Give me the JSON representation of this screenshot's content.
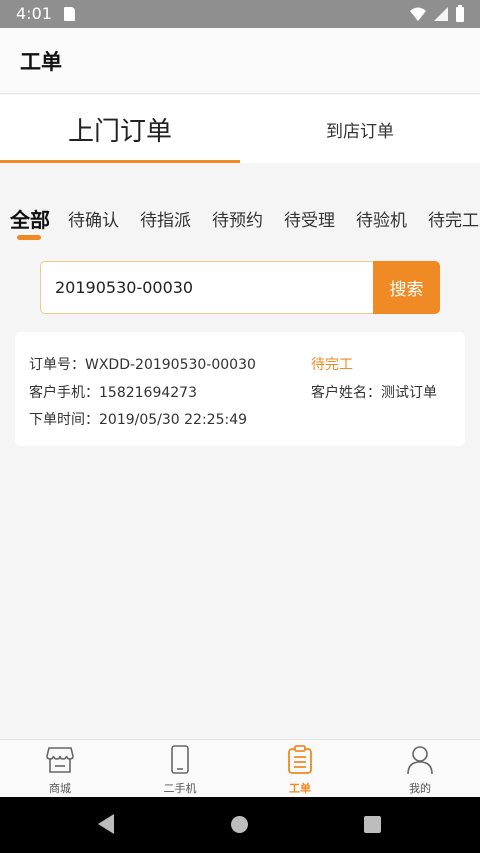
{
  "status_bar": {
    "time": "4:01"
  },
  "header": {
    "title": "工单"
  },
  "main_tabs": [
    {
      "label": "上门订单",
      "active": true
    },
    {
      "label": "到店订单",
      "active": false
    }
  ],
  "filter_tabs": [
    {
      "label": "全部",
      "active": true
    },
    {
      "label": "待确认"
    },
    {
      "label": "待指派"
    },
    {
      "label": "待预约"
    },
    {
      "label": "待受理"
    },
    {
      "label": "待验机"
    },
    {
      "label": "待完工"
    }
  ],
  "search": {
    "value": "20190530-00030",
    "button_label": "搜索"
  },
  "order": {
    "order_no": "订单号：WXDD-20190530-00030",
    "status": "待完工",
    "phone": "客户手机：15821694273",
    "customer_name": "客户姓名：测试订单",
    "order_time": "下单时间：2019/05/30 22:25:49"
  },
  "bottom_nav": [
    {
      "label": "商城",
      "icon": "store-icon"
    },
    {
      "label": "二手机",
      "icon": "phone-icon"
    },
    {
      "label": "工单",
      "icon": "clipboard-icon",
      "active": true
    },
    {
      "label": "我的",
      "icon": "person-icon"
    }
  ],
  "colors": {
    "accent": "#f08a24"
  }
}
